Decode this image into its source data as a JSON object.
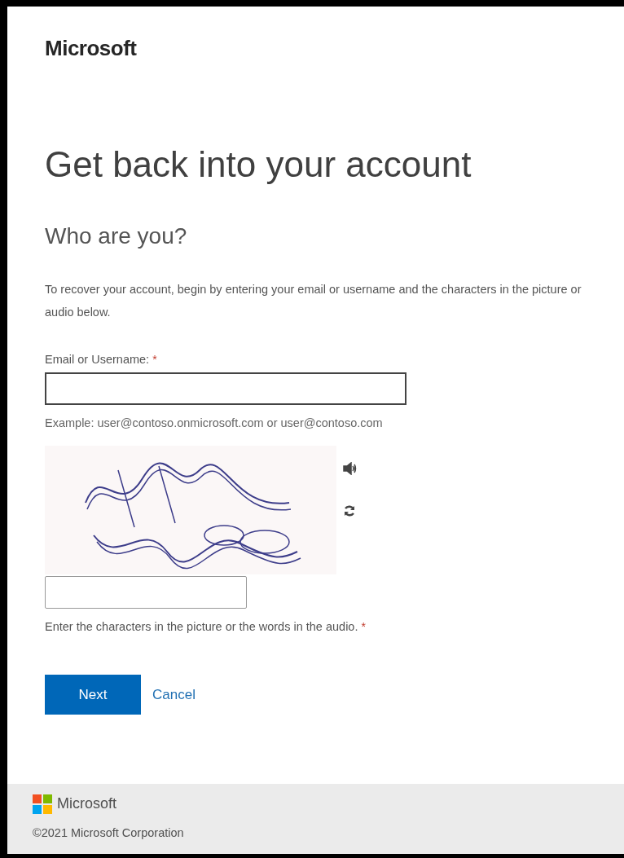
{
  "header": {
    "brand": "Microsoft"
  },
  "title": "Get back into your account",
  "subtitle": "Who are you?",
  "intro": "To recover your account, begin by entering your email or username and the characters in the picture or audio below.",
  "email_field": {
    "label": "Email or Username:",
    "required_mark": "*",
    "example": "Example: user@contoso.onmicrosoft.com or user@contoso.com"
  },
  "captcha_field": {
    "hint": "Enter the characters in the picture or the words in the audio.",
    "required_mark": "*"
  },
  "buttons": [
    {
      "kind": "primary",
      "label": "Next"
    },
    {
      "kind": "link",
      "label": "Cancel"
    }
  ],
  "footer": {
    "brand": "Microsoft",
    "copyright": "©2021 Microsoft Corporation"
  }
}
